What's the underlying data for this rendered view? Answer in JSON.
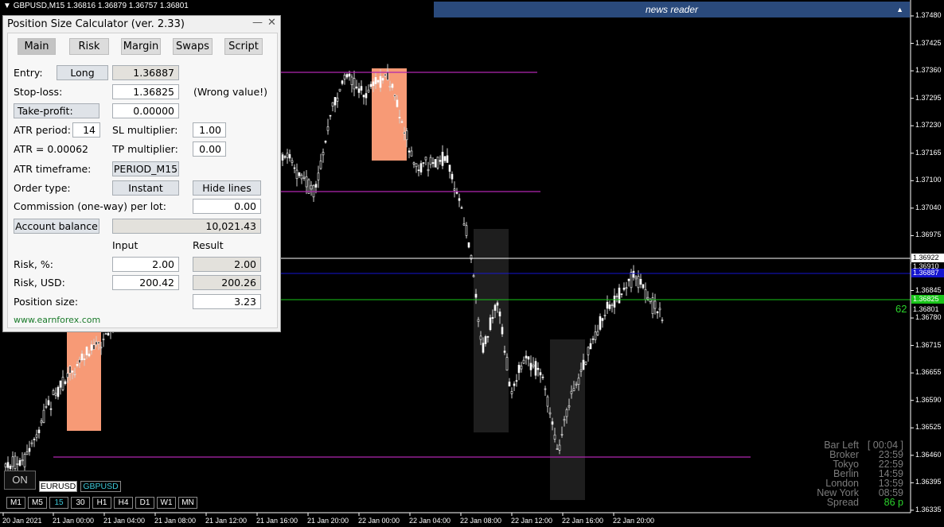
{
  "chart": {
    "title": "GBPUSD,M15  1.36816 1.36879 1.36757 1.36801",
    "price_labels": [
      "1.37480",
      "1.37425",
      "1.37360",
      "1.37295",
      "1.37230",
      "1.37165",
      "1.37100",
      "1.37040",
      "1.36975",
      "1.36910",
      "1.36845",
      "1.36780",
      "1.36715",
      "1.36655",
      "1.36590",
      "1.36525",
      "1.36460",
      "1.36395",
      "1.36335"
    ],
    "time_labels": [
      "20 Jan 2021",
      "21 Jan 00:00",
      "21 Jan 04:00",
      "21 Jan 08:00",
      "21 Jan 12:00",
      "21 Jan 16:00",
      "21 Jan 20:00",
      "22 Jan 00:00",
      "22 Jan 04:00",
      "22 Jan 08:00",
      "22 Jan 12:00",
      "22 Jan 16:00",
      "22 Jan 20:00"
    ],
    "price_tags": [
      {
        "text": "1.36922",
        "bg": "#ffffff",
        "color": "#000000"
      },
      {
        "text": "1.36910",
        "bg": "#000000",
        "color": "#ffffff"
      },
      {
        "text": "1.36887",
        "bg": "#1515d0",
        "color": "#ffffff"
      },
      {
        "text": "1.36825",
        "bg": "#19c419",
        "color": "#ffffff"
      },
      {
        "text": "1.36801",
        "bg": "#000000",
        "color": "#ffffff"
      }
    ],
    "sl_pips": "62",
    "colors": {
      "entry": "#1515d0",
      "stop_loss": "#19c419",
      "ask": "#ffffff",
      "session_box": "#f79a76",
      "highlight": "#1e1e1e",
      "level": "#b026b0"
    }
  },
  "news": {
    "label": "news reader",
    "arrow": "▲"
  },
  "panel": {
    "title": "Position Size Calculator (ver. 2.33)",
    "minimize": "—",
    "close": "✕",
    "tabs": [
      "Main",
      "Risk",
      "Margin",
      "Swaps",
      "Script"
    ],
    "entry_label": "Entry:",
    "direction_button": "Long",
    "entry_value": "1.36887",
    "stoploss_label": "Stop-loss:",
    "stoploss_value": "1.36825",
    "stoploss_warning": "(Wrong value!)",
    "takeprofit_button": "Take-profit:",
    "takeprofit_value": "0.00000",
    "atr_period_label": "ATR period:",
    "atr_period_value": "14",
    "sl_multiplier_label": "SL multiplier:",
    "sl_multiplier_value": "1.00",
    "atr_label": "ATR = 0.00062",
    "tp_multiplier_label": "TP multiplier:",
    "tp_multiplier_value": "0.00",
    "atr_timeframe_label": "ATR timeframe:",
    "atr_timeframe_value": "PERIOD_M15",
    "order_type_label": "Order type:",
    "order_type_button": "Instant",
    "hide_lines_button": "Hide lines",
    "commission_label": "Commission (one-way) per lot:",
    "commission_value": "0.00",
    "account_balance_button": "Account balance",
    "account_balance_value": "10,021.43",
    "input_header": "Input",
    "result_header": "Result",
    "risk_pct_label": "Risk, %:",
    "risk_pct_input": "2.00",
    "risk_pct_result": "2.00",
    "risk_usd_label": "Risk, USD:",
    "risk_usd_input": "200.42",
    "risk_usd_result": "200.26",
    "position_size_label": "Position size:",
    "position_size_value": "3.23",
    "website": "www.earnforex.com"
  },
  "bar_info": {
    "rows": [
      {
        "key": "Bar Left",
        "value": "[ 00:04 ]"
      },
      {
        "key": "Broker",
        "value": "23:59"
      },
      {
        "key": "Tokyo",
        "value": "22:59"
      },
      {
        "key": "Berlin",
        "value": "14:59"
      },
      {
        "key": "London",
        "value": "13:59"
      },
      {
        "key": "New York",
        "value": "08:59"
      },
      {
        "key": "Spread",
        "value": "86 p"
      }
    ],
    "spread_color": "#2bd12b"
  },
  "bottom": {
    "on_button": "ON",
    "symbols": [
      "EURUSD",
      "GBPUSD"
    ],
    "active_symbol": "GBPUSD",
    "timeframes": [
      "M1",
      "M5",
      "15",
      "30",
      "H1",
      "H4",
      "D1",
      "W1",
      "MN"
    ],
    "active_timeframe": "15"
  }
}
